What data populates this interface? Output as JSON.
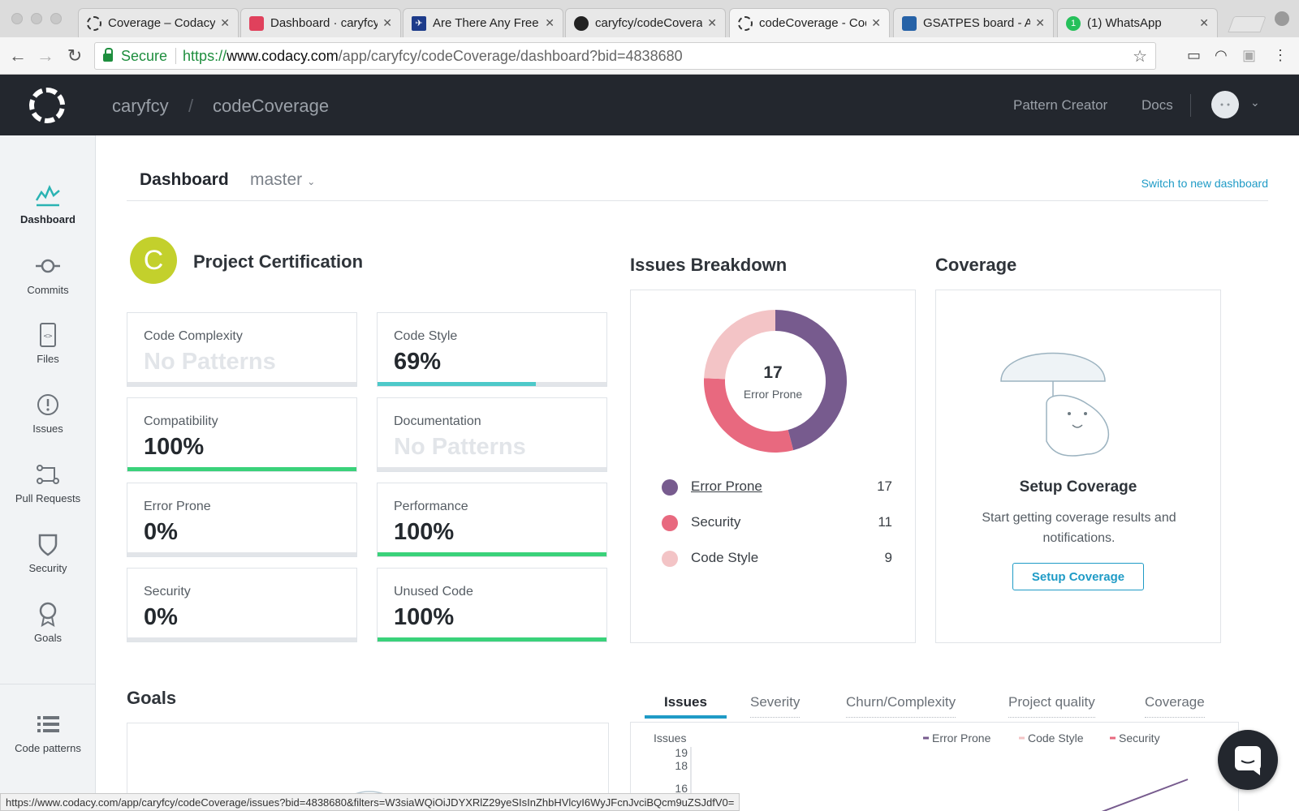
{
  "browser": {
    "tabs": [
      {
        "label": "Coverage – Codacy",
        "icon": "codacy-icon",
        "active": false
      },
      {
        "label": "Dashboard · caryfcy",
        "icon": "codeclimate-icon",
        "active": false
      },
      {
        "label": "Are There Any Free",
        "icon": "plane-icon",
        "active": false
      },
      {
        "label": "caryfcy/codeCoverage",
        "icon": "github-icon",
        "active": false
      },
      {
        "label": "codeCoverage - Codacy",
        "icon": "codacy-icon",
        "active": true
      },
      {
        "label": "GSATPES board - Agile",
        "icon": "jira-icon",
        "active": false
      },
      {
        "label": "(1) WhatsApp",
        "icon": "whatsapp-icon",
        "active": false
      }
    ],
    "secure_label": "Secure",
    "url_scheme": "https://",
    "url_host": "www.codacy.com",
    "url_path": "/app/caryfcy/codeCoverage/dashboard?bid=4838680",
    "status_url": "https://www.codacy.com/app/caryfcy/codeCoverage/issues?bid=4838680&filters=W3siaWQiOiJDYXRlZ29yeSIsInZhbHVlcyI6WyJFcnJvciBQcm9uZSJdfV0="
  },
  "appnav": {
    "org": "caryfcy",
    "separator": "/",
    "repo": "codeCoverage",
    "links": [
      "Pattern Creator",
      "Docs"
    ]
  },
  "sidebar": {
    "items": [
      {
        "label": "Dashboard",
        "icon": "chart-icon"
      },
      {
        "label": "Commits",
        "icon": "commit-icon"
      },
      {
        "label": "Files",
        "icon": "file-code-icon"
      },
      {
        "label": "Issues",
        "icon": "alert-icon"
      },
      {
        "label": "Pull Requests",
        "icon": "pull-request-icon"
      },
      {
        "label": "Security",
        "icon": "shield-icon"
      },
      {
        "label": "Goals",
        "icon": "award-icon"
      },
      {
        "label": "Code patterns",
        "icon": "list-icon"
      }
    ]
  },
  "header": {
    "title": "Dashboard",
    "branch": "master",
    "switch_link": "Switch to new dashboard"
  },
  "certification": {
    "grade": "C",
    "title": "Project Certification",
    "grade_color": "#c3d02c",
    "metrics": [
      {
        "label": "Code Complexity",
        "value": "No Patterns",
        "progress": 0,
        "na": true
      },
      {
        "label": "Code Style",
        "value": "69%",
        "progress": 0.69,
        "color": "#4dc9c9"
      },
      {
        "label": "Compatibility",
        "value": "100%",
        "progress": 1.0,
        "color": "#3ad27a"
      },
      {
        "label": "Documentation",
        "value": "No Patterns",
        "progress": 0,
        "na": true
      },
      {
        "label": "Error Prone",
        "value": "0%",
        "progress": 0
      },
      {
        "label": "Performance",
        "value": "100%",
        "progress": 1.0,
        "color": "#3ad27a"
      },
      {
        "label": "Security",
        "value": "0%",
        "progress": 0
      },
      {
        "label": "Unused Code",
        "value": "100%",
        "progress": 1.0,
        "color": "#3ad27a"
      }
    ]
  },
  "issues_breakdown": {
    "title": "Issues Breakdown",
    "center_value": "17",
    "center_label": "Error Prone",
    "items": [
      {
        "name": "Error Prone",
        "count": 17,
        "color": "#775b8e"
      },
      {
        "name": "Security",
        "count": 11,
        "color": "#e8697f"
      },
      {
        "name": "Code Style",
        "count": 9,
        "color": "#f3c4c6"
      }
    ]
  },
  "coverage": {
    "title": "Coverage",
    "setup_title": "Setup Coverage",
    "text": "Start getting coverage results and notifications.",
    "button": "Setup Coverage"
  },
  "goals": {
    "title": "Goals"
  },
  "chart_tabs": [
    "Issues",
    "Severity",
    "Churn/Complexity",
    "Project quality",
    "Coverage"
  ],
  "chart_data": {
    "type": "line",
    "ylabel": "Issues",
    "y_ticks": [
      "19",
      "18",
      "16"
    ],
    "series": [
      {
        "name": "Error Prone",
        "color": "#775b8e"
      },
      {
        "name": "Code Style",
        "color": "#f3c4c6"
      },
      {
        "name": "Security",
        "color": "#e8697f"
      }
    ]
  }
}
